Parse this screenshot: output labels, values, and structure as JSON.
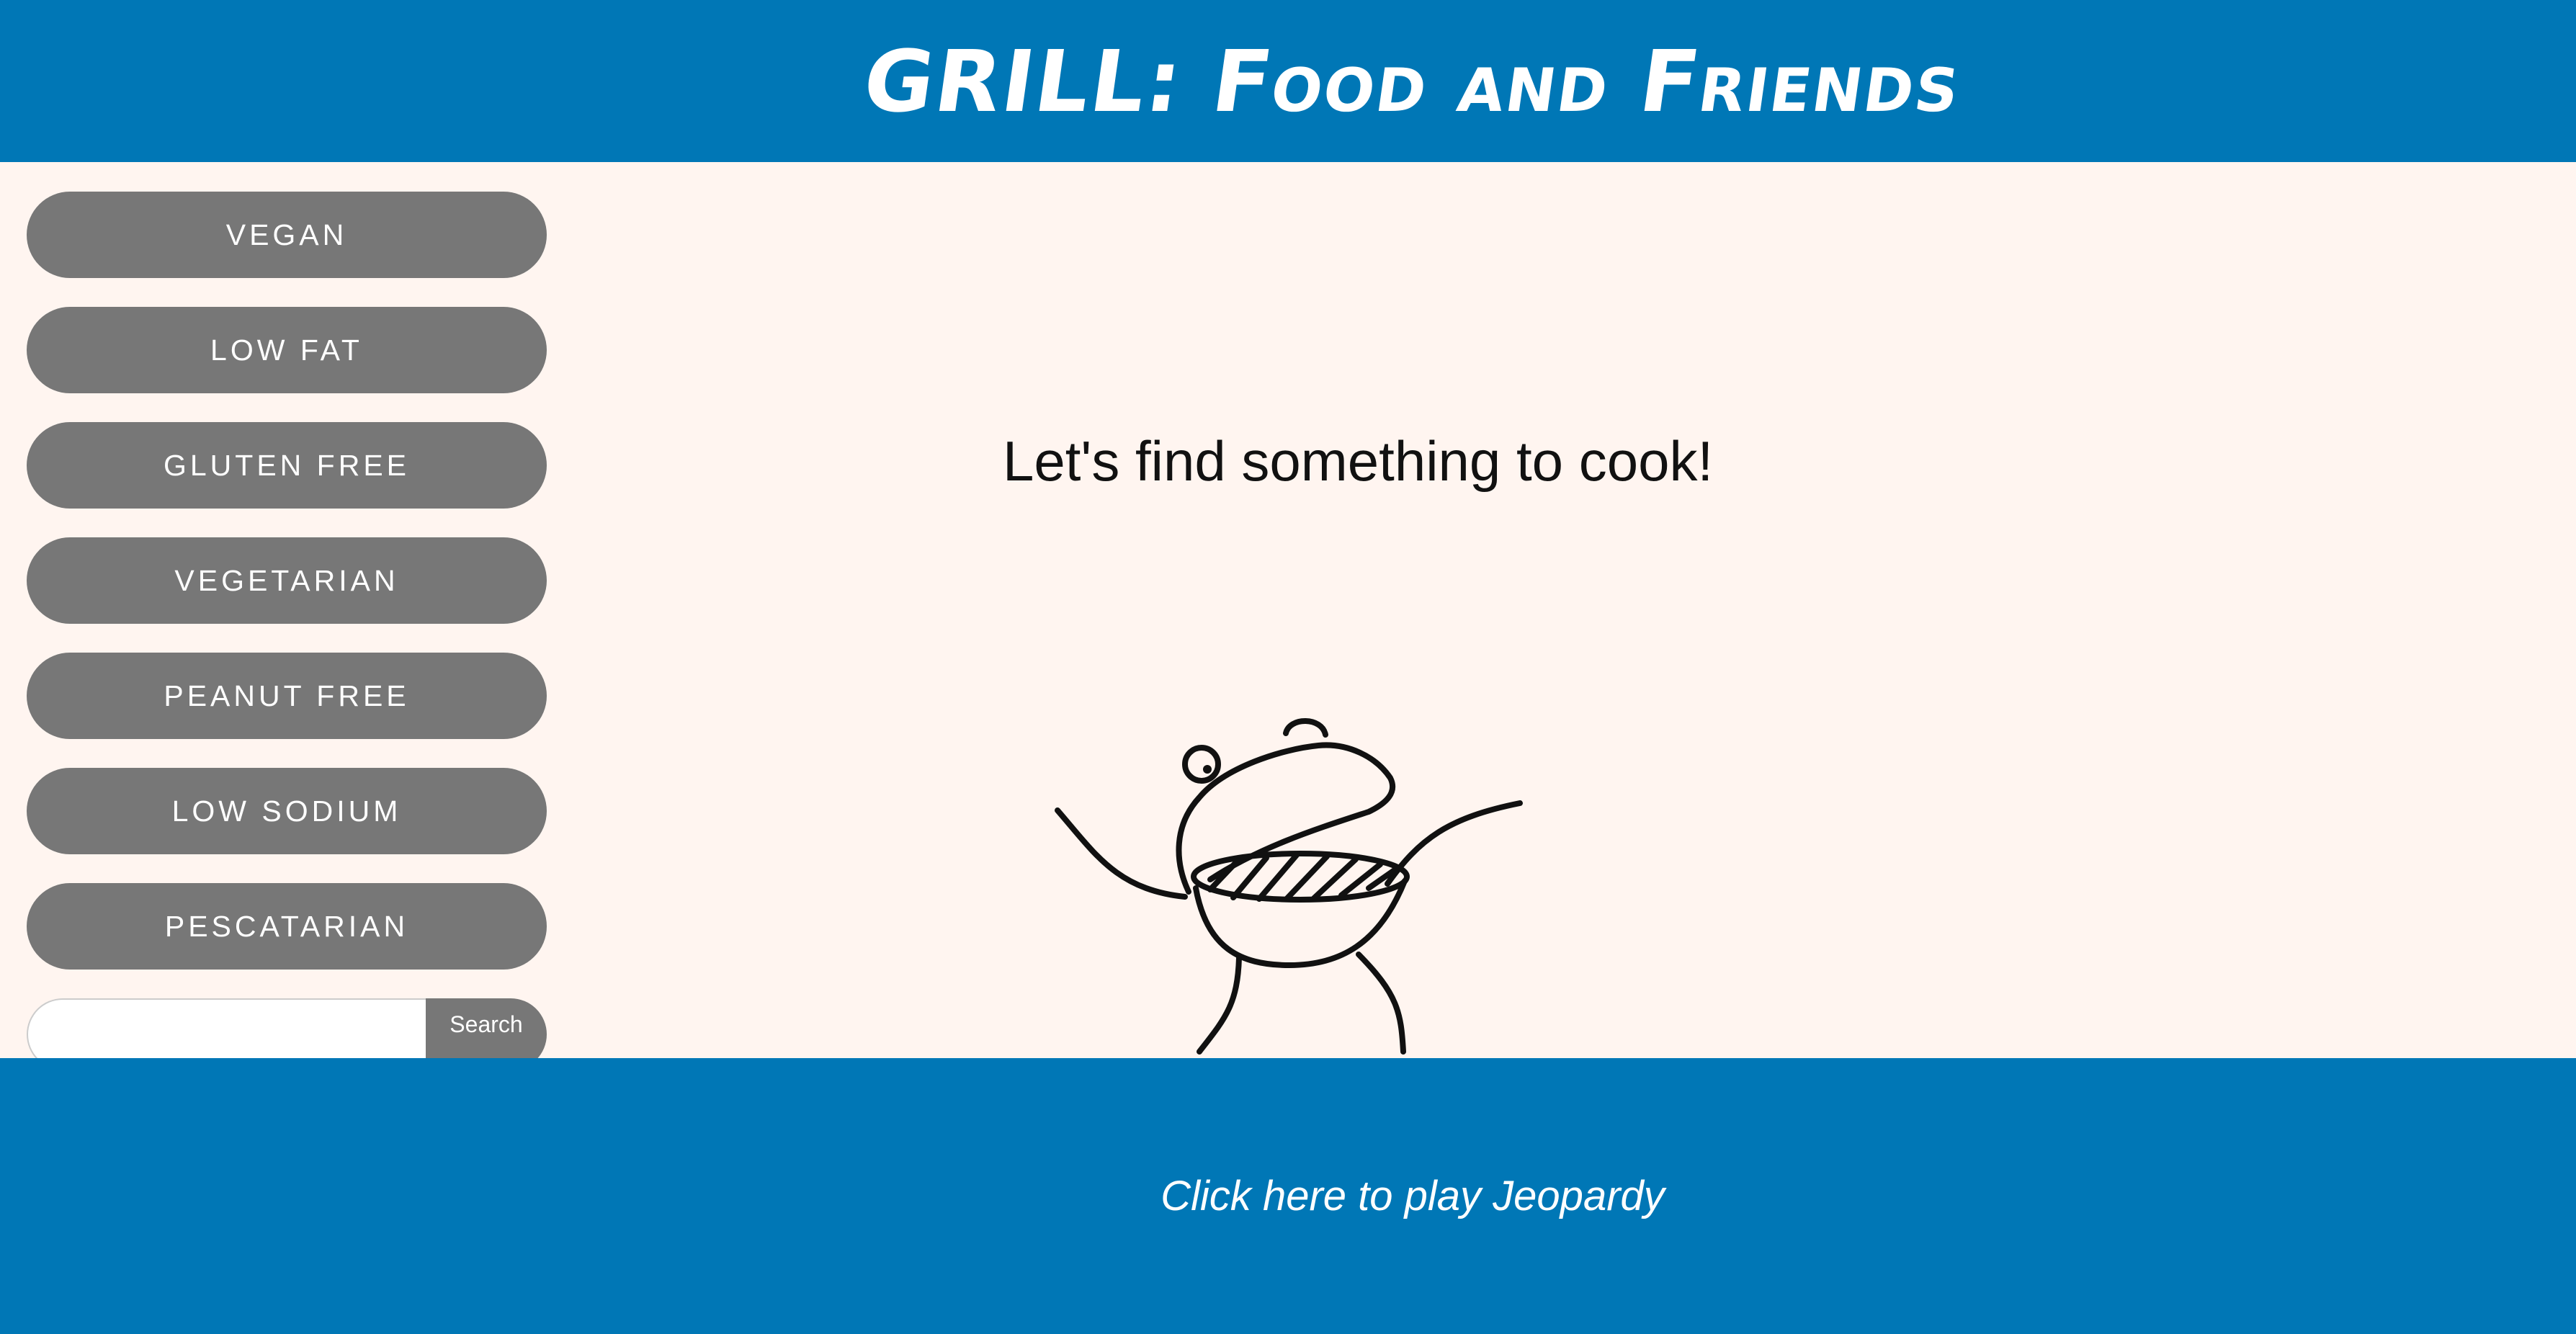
{
  "header": {
    "title": "GRILL: Food and Friends"
  },
  "sidebar": {
    "filters": [
      {
        "label": "VEGAN"
      },
      {
        "label": "LOW FAT"
      },
      {
        "label": "GLUTEN FREE"
      },
      {
        "label": "VEGETARIAN"
      },
      {
        "label": "PEANUT FREE"
      },
      {
        "label": "LOW SODIUM"
      },
      {
        "label": "PESCATARIAN"
      }
    ],
    "search": {
      "value": "",
      "placeholder": "",
      "button_label": "Search"
    }
  },
  "main": {
    "prompt": "Let's find something to cook!",
    "illustration_icon": "grill-character-icon"
  },
  "footer": {
    "link_text": "Click here to play Jeopardy"
  },
  "colors": {
    "header_bg": "#0077b6",
    "main_bg": "#fff5f0",
    "button_bg": "#777777",
    "text_light": "#ffffff"
  }
}
